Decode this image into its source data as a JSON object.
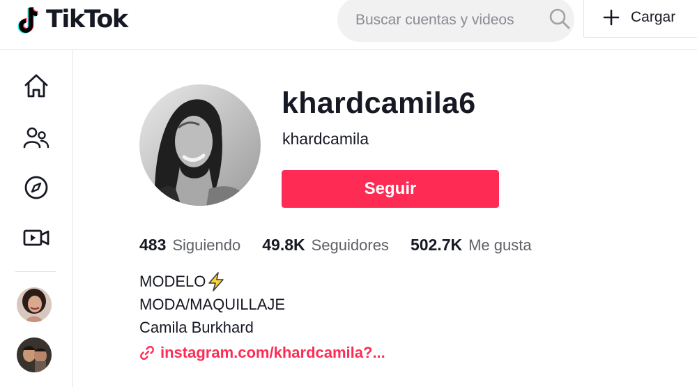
{
  "brand": {
    "name": "TikTok"
  },
  "search": {
    "placeholder": "Buscar cuentas y videos",
    "value": ""
  },
  "header": {
    "upload_label": "Cargar"
  },
  "sidebar": {
    "nav": [
      {
        "icon": "home-icon"
      },
      {
        "icon": "following-icon"
      },
      {
        "icon": "explore-icon"
      },
      {
        "icon": "live-icon"
      }
    ],
    "suggested_accounts": [
      {
        "icon": "avatar"
      },
      {
        "icon": "avatar"
      }
    ]
  },
  "profile": {
    "title": "khardcamila6",
    "subtitle": "khardcamila",
    "follow_label": "Seguir",
    "stats": [
      {
        "value": "483",
        "label": "Siguiendo"
      },
      {
        "value": "49.8K",
        "label": "Seguidores"
      },
      {
        "value": "502.7K",
        "label": "Me gusta"
      }
    ],
    "bio": [
      "MODELO",
      "MODA/MAQUILLAJE",
      "Camila Burkhard"
    ],
    "link": "instagram.com/khardcamila?..."
  },
  "colors": {
    "accent": "#fe2c55",
    "text": "#161823",
    "muted": "#5e6068",
    "search_bg": "#f1f1f2",
    "border": "#e3e3e4"
  }
}
